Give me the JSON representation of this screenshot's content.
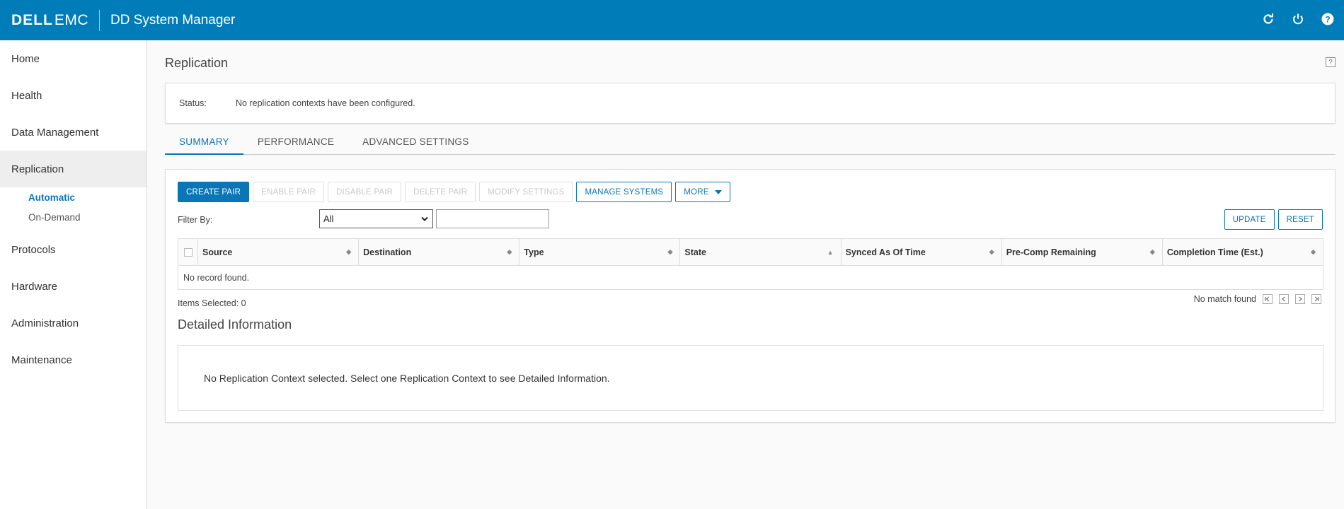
{
  "header": {
    "logo_bold": "DELL",
    "logo_light": "EMC",
    "title": "DD System Manager",
    "icons": [
      "refresh-icon",
      "power-icon",
      "help-icon"
    ]
  },
  "sidebar": {
    "items": [
      {
        "label": "Home"
      },
      {
        "label": "Health"
      },
      {
        "label": "Data Management"
      },
      {
        "label": "Replication",
        "active": true,
        "children": [
          {
            "label": "Automatic",
            "active": true
          },
          {
            "label": "On-Demand"
          }
        ]
      },
      {
        "label": "Protocols"
      },
      {
        "label": "Hardware"
      },
      {
        "label": "Administration"
      },
      {
        "label": "Maintenance"
      }
    ]
  },
  "page": {
    "title": "Replication",
    "help_label": "?"
  },
  "status": {
    "label": "Status:",
    "value": "No replication contexts have been configured."
  },
  "tabs": [
    {
      "label": "SUMMARY",
      "active": true
    },
    {
      "label": "PERFORMANCE"
    },
    {
      "label": "ADVANCED SETTINGS"
    }
  ],
  "toolbar": {
    "create_pair": "CREATE PAIR",
    "enable_pair": "ENABLE PAIR",
    "disable_pair": "DISABLE PAIR",
    "delete_pair": "DELETE PAIR",
    "modify_settings": "MODIFY SETTINGS",
    "manage_systems": "MANAGE SYSTEMS",
    "more": "MORE"
  },
  "filter": {
    "label": "Filter By:",
    "selected": "All",
    "text_value": "",
    "update": "UPDATE",
    "reset": "RESET"
  },
  "grid": {
    "columns": [
      "Source",
      "Destination",
      "Type",
      "State",
      "Synced As Of Time",
      "Pre-Comp Remaining",
      "Completion Time (Est.)"
    ],
    "empty_text": "No record found.",
    "items_selected": "Items Selected: 0",
    "pager_text": "No match found"
  },
  "detail": {
    "title": "Detailed Information",
    "message": "No Replication Context selected. Select one Replication Context to see Detailed Information."
  },
  "colors": {
    "brand": "#007db8",
    "accent": "#0a76b7"
  }
}
